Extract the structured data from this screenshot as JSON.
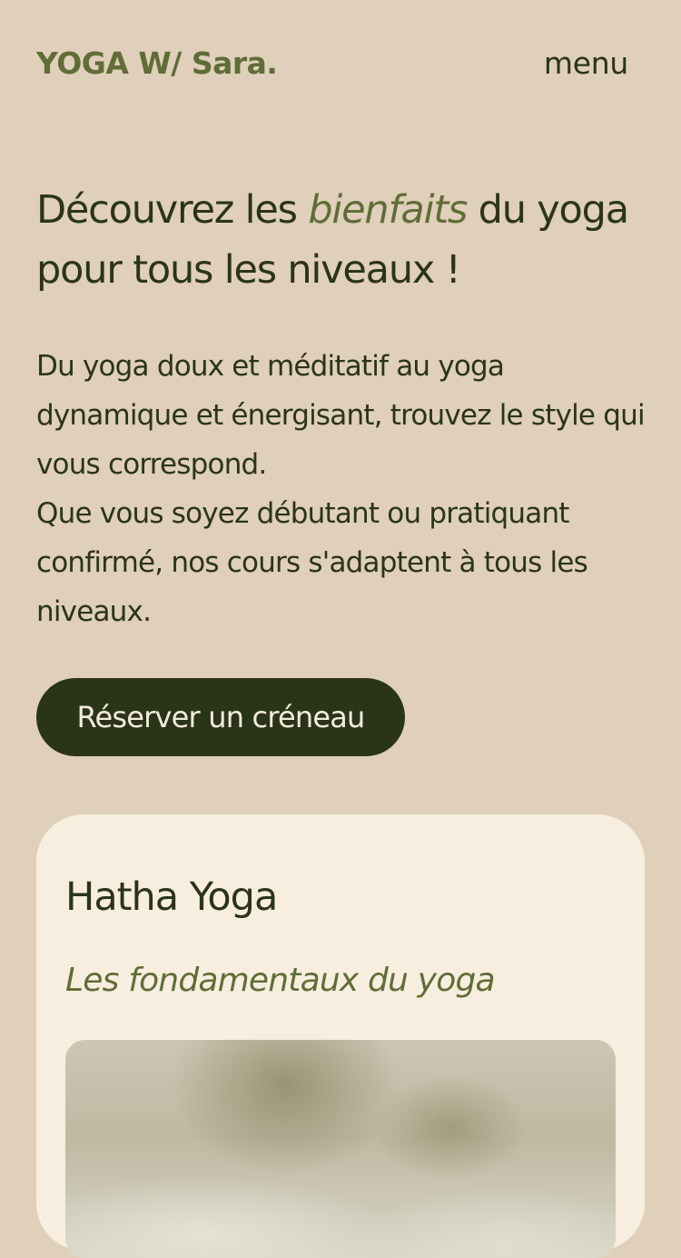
{
  "header": {
    "logo": "YOGA W/ Sara.",
    "menu_label": "menu"
  },
  "hero": {
    "headline_before": "Découvrez les ",
    "headline_accent": "bienfaits",
    "headline_after": " du yoga pour tous les niveaux !",
    "intro_line1": "Du yoga doux et méditatif au yoga dynamique et énergisant, trouvez le style qui vous correspond.",
    "intro_line2": "Que vous soyez débutant ou pratiquant confirmé, nos cours s'adaptent à tous les niveaux.",
    "cta_label": "Réserver un créneau"
  },
  "card": {
    "title": "Hatha Yoga",
    "subtitle": "Les fondamentaux du yoga"
  },
  "colors": {
    "background": "#e0cfbb",
    "dark_green": "#2a3518",
    "olive": "#5f6d36",
    "card_bg": "#f7eedf"
  }
}
